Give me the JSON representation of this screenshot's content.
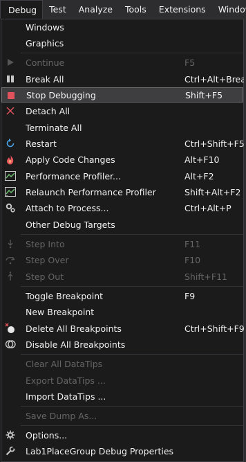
{
  "menubar": {
    "items": [
      "Debug",
      "Test",
      "Analyze",
      "Tools",
      "Extensions",
      "Window"
    ]
  },
  "menu": {
    "windows": {
      "label": "Windows"
    },
    "graphics": {
      "label": "Graphics"
    },
    "continue": {
      "label": "Continue",
      "shortcut": "F5"
    },
    "break_all": {
      "label": "Break All",
      "shortcut": "Ctrl+Alt+Break"
    },
    "stop_debugging": {
      "label": "Stop Debugging",
      "shortcut": "Shift+F5"
    },
    "detach_all": {
      "label": "Detach All"
    },
    "terminate_all": {
      "label": "Terminate All"
    },
    "restart": {
      "label": "Restart",
      "shortcut": "Ctrl+Shift+F5"
    },
    "apply_code_changes": {
      "label": "Apply Code Changes",
      "shortcut": "Alt+F10"
    },
    "performance_profiler": {
      "label": "Performance Profiler...",
      "shortcut": "Alt+F2"
    },
    "relaunch_profiler": {
      "label": "Relaunch Performance Profiler",
      "shortcut": "Shift+Alt+F2"
    },
    "attach_to_process": {
      "label": "Attach to Process...",
      "shortcut": "Ctrl+Alt+P"
    },
    "other_debug_targets": {
      "label": "Other Debug Targets"
    },
    "step_into": {
      "label": "Step Into",
      "shortcut": "F11"
    },
    "step_over": {
      "label": "Step Over",
      "shortcut": "F10"
    },
    "step_out": {
      "label": "Step Out",
      "shortcut": "Shift+F11"
    },
    "toggle_breakpoint": {
      "label": "Toggle Breakpoint",
      "shortcut": "F9"
    },
    "new_breakpoint": {
      "label": "New Breakpoint"
    },
    "delete_all_breakpoints": {
      "label": "Delete All Breakpoints",
      "shortcut": "Ctrl+Shift+F9"
    },
    "disable_all_breakpoints": {
      "label": "Disable All Breakpoints"
    },
    "clear_all_datatips": {
      "label": "Clear All DataTips"
    },
    "export_datatips": {
      "label": "Export DataTips ..."
    },
    "import_datatips": {
      "label": "Import DataTips ..."
    },
    "save_dump": {
      "label": "Save Dump As..."
    },
    "options": {
      "label": "Options..."
    },
    "debug_properties": {
      "label": "Lab1PlaceGroup Debug Properties"
    }
  },
  "colors": {
    "background": "#1b1b1c",
    "menubar": "#2d2d30",
    "highlight": "#3e3e40",
    "text": "#f1f1f1",
    "disabled_text": "#656565",
    "stop_red": "#e0535c",
    "restart_blue": "#4aa3e8",
    "profiler_green": "#6fbf73"
  }
}
